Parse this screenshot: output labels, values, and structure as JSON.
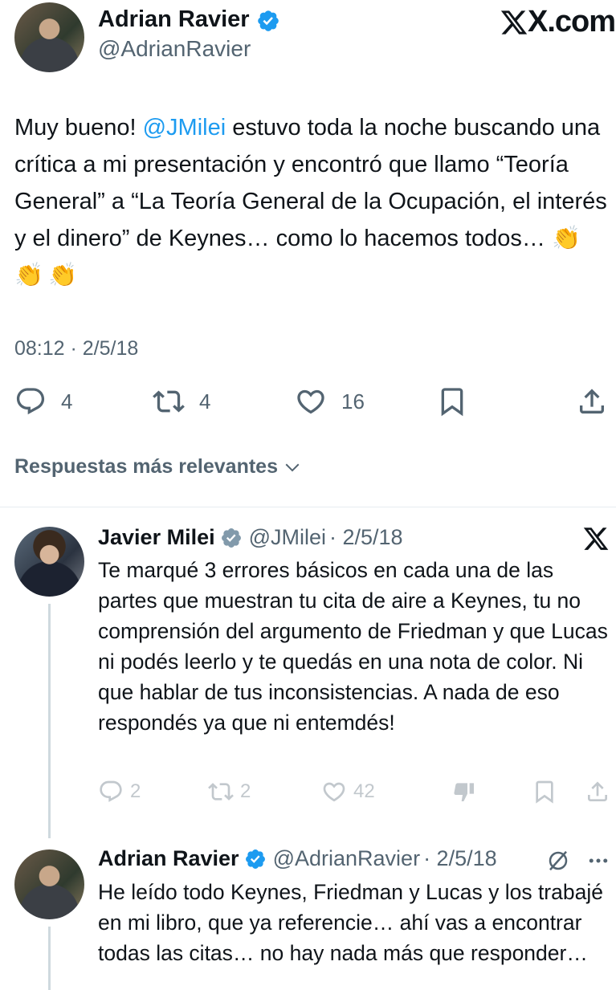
{
  "header": {
    "author_name": "Adrian Ravier",
    "author_handle": "@AdrianRavier",
    "brand": "X.com"
  },
  "tweet": {
    "text_before": "Muy bueno! ",
    "mention": "@JMilei",
    "text_after": " estuvo toda la noche buscando una crítica a mi presentación y encontró que llamo “Teoría General” a “La Teoría General de la Ocupación, el interés y el dinero” de Keynes… como lo hacemos todos… ",
    "emojis": "👏👏👏",
    "timestamp": "08:12 · 2/5/18",
    "replies": "4",
    "retweets": "4",
    "likes": "16"
  },
  "replies_sort": {
    "label": "Respuestas más relevantes"
  },
  "reply1": {
    "name": "Javier Milei",
    "handle": "@JMilei",
    "date": "· 2/5/18",
    "text": "Te marqué 3 errores básicos en cada una de las partes que muestran tu cita de aire a Keynes, tu no comprensión del argumento de Friedman y que Lucas ni podés leerlo y te quedás en una nota de color. Ni que hablar de tus inconsistencias. A nada de eso respondés ya que ni entemdés!",
    "replies": "2",
    "retweets": "2",
    "likes": "42"
  },
  "reply2": {
    "name": "Adrian Ravier",
    "handle": "@AdrianRavier",
    "date": "· 2/5/18",
    "text": "He leído todo Keynes, Friedman y Lucas y los trabajé en mi libro, que ya referencie… ahí vas a encontrar todas las citas… no hay nada más que responder…"
  },
  "colors": {
    "accent": "#1d9bf0",
    "text": "#0f1419",
    "muted": "#536471",
    "verified": "#1d9bf0"
  },
  "icons": [
    "verified-badge-icon",
    "x-logo-icon",
    "reply-icon",
    "retweet-icon",
    "like-icon",
    "bookmark-icon",
    "share-icon",
    "chevron-down-icon",
    "not-interested-icon",
    "grok-icon",
    "more-icon"
  ]
}
